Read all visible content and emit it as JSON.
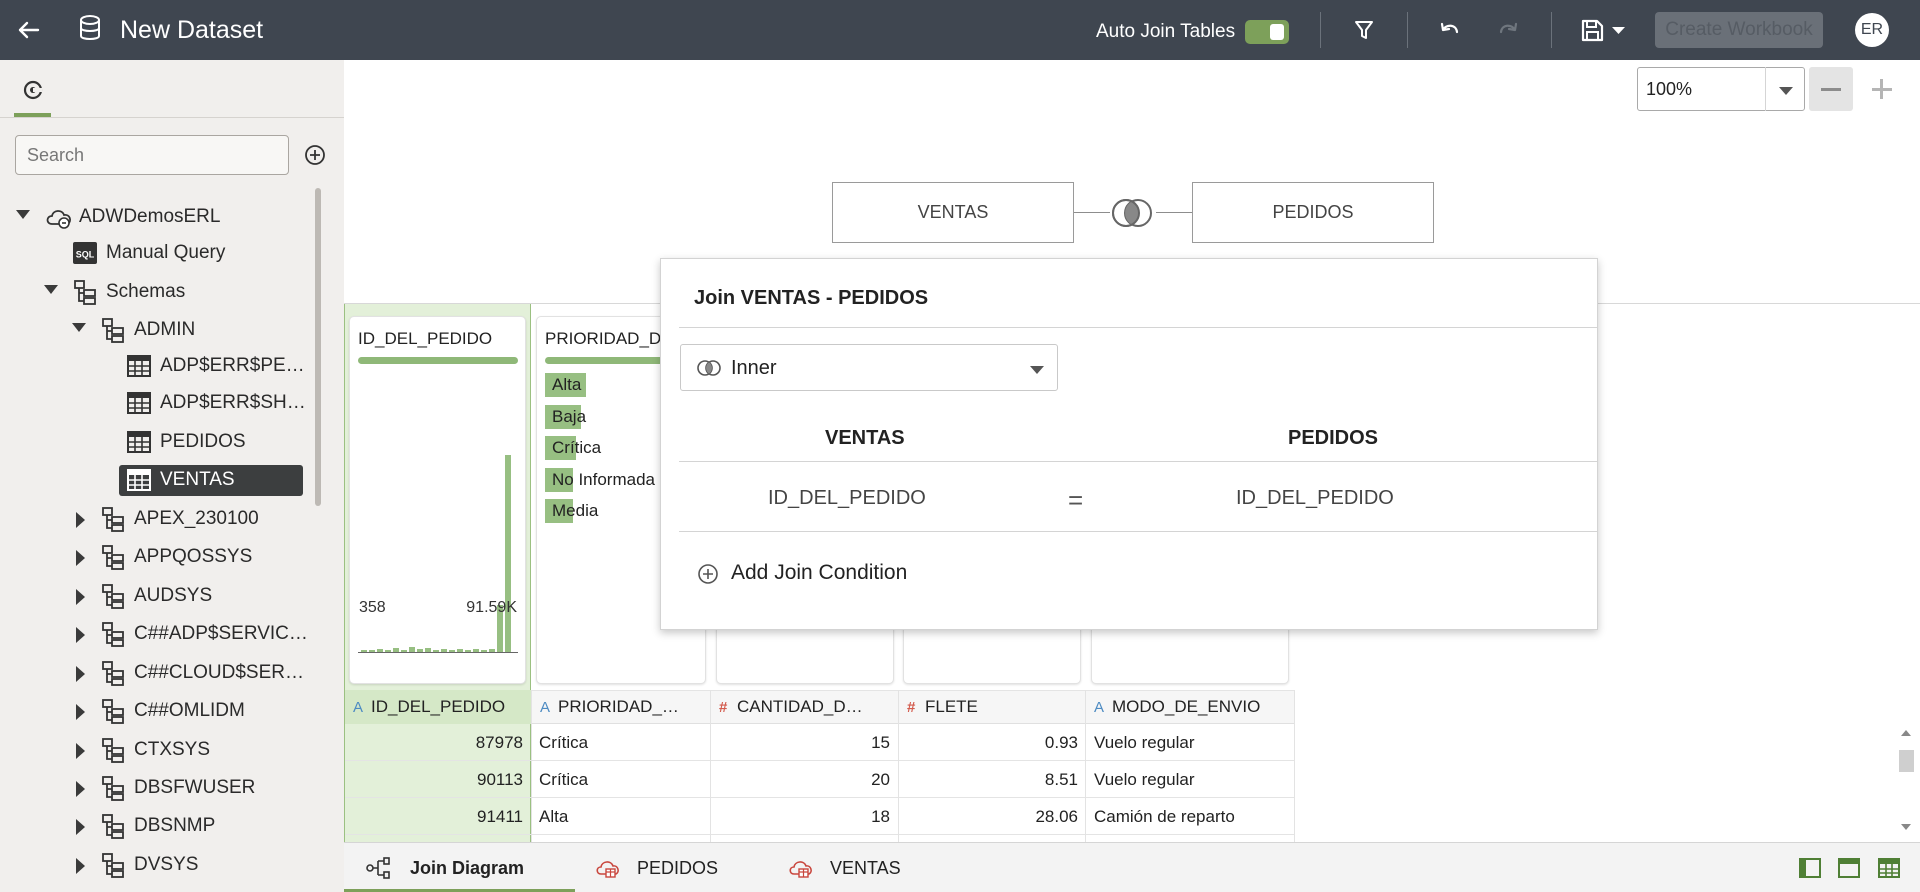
{
  "header": {
    "title": "New Dataset",
    "auto_join_label": "Auto Join Tables",
    "auto_join_enabled": true,
    "create_workbook_label": "Create Workbook",
    "avatar_initials": "ER"
  },
  "left_panel": {
    "search_placeholder": "Search",
    "tree": {
      "connection": "ADWDemosERL",
      "manual_query": "Manual Query",
      "schemas_label": "Schemas",
      "admin_schema": "ADMIN",
      "admin_tables": [
        "ADP$ERR$PE…",
        "ADP$ERR$SH…",
        "PEDIDOS",
        "VENTAS"
      ],
      "other_schemas": [
        "APEX_230100",
        "APPQOSSYS",
        "AUDSYS",
        "C##ADP$SERVIC…",
        "C##CLOUD$SER…",
        "C##OMLIDM",
        "CTXSYS",
        "DBSFWUSER",
        "DBSNMP",
        "DVSYS"
      ],
      "selected_table": "VENTAS"
    }
  },
  "canvas": {
    "zoom": "100%",
    "left_table": "VENTAS",
    "right_table": "PEDIDOS"
  },
  "join_popup": {
    "title": "Join VENTAS - PEDIDOS",
    "join_type": "Inner",
    "left_header": "VENTAS",
    "right_header": "PEDIDOS",
    "left_column": "ID_DEL_PEDIDO",
    "operator": "=",
    "right_column": "ID_DEL_PEDIDO",
    "add_condition_label": "Add Join Condition"
  },
  "preview": {
    "cards": [
      {
        "name": "ID_DEL_PEDIDO",
        "min": "358",
        "max": "91.59K"
      },
      {
        "name": "PRIORIDAD_DE",
        "categories": [
          "Alta",
          "Baja",
          "Crítica",
          "No Informada",
          "Media"
        ]
      }
    ],
    "columns": [
      {
        "type": "A",
        "name": "ID_DEL_PEDIDO"
      },
      {
        "type": "A",
        "name": "PRIORIDAD_…"
      },
      {
        "type": "#",
        "name": "CANTIDAD_D…"
      },
      {
        "type": "#",
        "name": "FLETE"
      },
      {
        "type": "A",
        "name": "MODO_DE_ENVIO"
      }
    ],
    "rows": [
      [
        "87978",
        "Crítica",
        "15",
        "0.93",
        "Vuelo regular"
      ],
      [
        "90113",
        "Crítica",
        "20",
        "8.51",
        "Vuelo regular"
      ],
      [
        "91411",
        "Alta",
        "18",
        "28.06",
        "Camión de reparto"
      ]
    ]
  },
  "bottom_tabs": [
    {
      "label": "Join Diagram",
      "active": true
    },
    {
      "label": "PEDIDOS",
      "active": false
    },
    {
      "label": "VENTAS",
      "active": false
    }
  ],
  "colors": {
    "header_bg": "#3f4650",
    "accent_green": "#7da05a",
    "selected_bg": "#3c3e3f"
  }
}
